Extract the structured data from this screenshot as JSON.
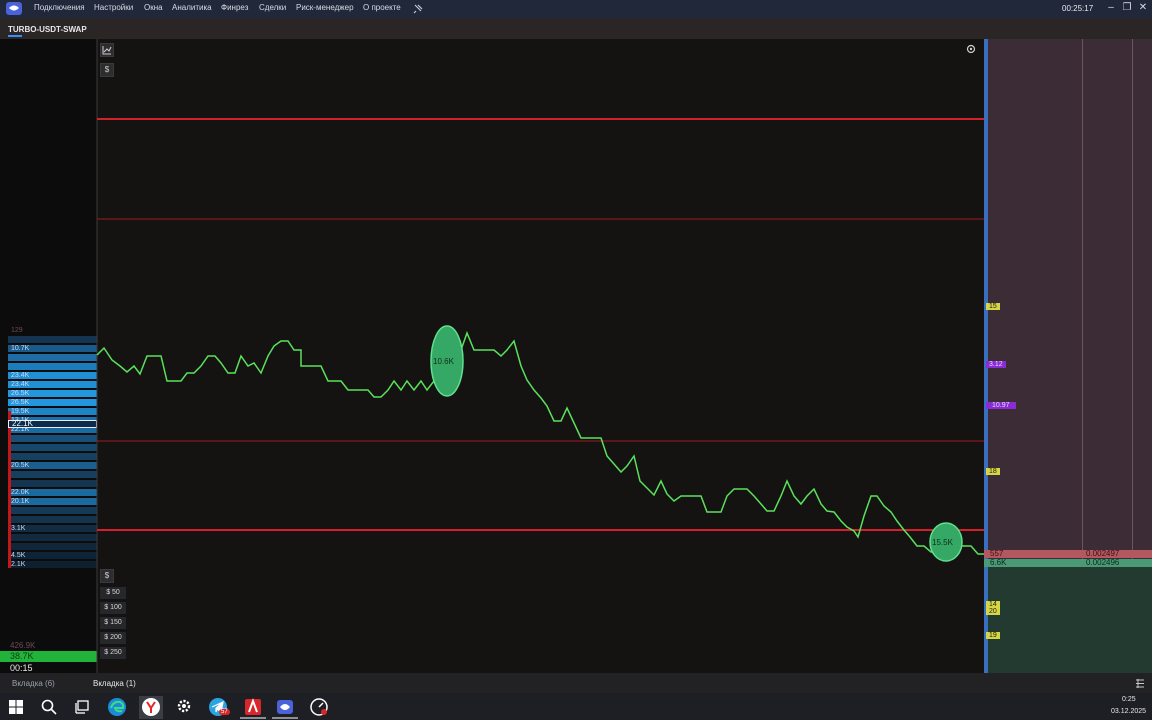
{
  "menu": {
    "items": [
      "Подключения",
      "Настройки",
      "Окна",
      "Аналитика",
      "Финрез",
      "Сделки",
      "Риск-менеджер",
      "О проекте"
    ],
    "clock": "00:25:17",
    "pin_icon": "pin-icon"
  },
  "window_controls": {
    "minimize": "–",
    "restore": "❐",
    "close": "✕"
  },
  "instrument": "TURBO-USDT-SWAP",
  "dom_left": {
    "rows": [
      "129",
      "",
      "10.7K",
      "",
      "",
      "23.4K",
      "23.4K",
      "26.5K",
      "26.5K",
      "19.5K",
      "13.1K",
      "22.1K",
      "",
      "",
      "",
      "20.5K",
      "",
      "",
      "22.0K",
      "20.1K",
      "",
      "",
      "3.1K",
      "",
      "",
      "4.5K",
      "2.1K"
    ],
    "highlight_value": "22.1K",
    "bottom_total": "426.9K",
    "green_value": "38.7K",
    "timeframe": "00:15"
  },
  "chart": {
    "big_trades": [
      {
        "label": "10.6K"
      },
      {
        "label": "15.5K"
      }
    ],
    "currency_button": "$",
    "quick_amounts": [
      "$ 50",
      "$ 100",
      "$ 150",
      "$ 200",
      "$ 250"
    ],
    "line_color": "#59e25a",
    "level_color": "#d4202a"
  },
  "right_panel": {
    "ask_volume": "557",
    "bid_volume": "6.6K",
    "ask_price": "0.002497",
    "bid_price": "0.002496",
    "markers": [
      "15",
      "19",
      "18",
      "14",
      "20",
      "19"
    ],
    "purple_markers": [
      "3.12",
      "10.97"
    ]
  },
  "tabs": [
    "Вкладка (6)",
    "Вкладка (1)"
  ],
  "taskbar": {
    "time": "0:25",
    "date": "03.12.2025",
    "badge": "57"
  }
}
